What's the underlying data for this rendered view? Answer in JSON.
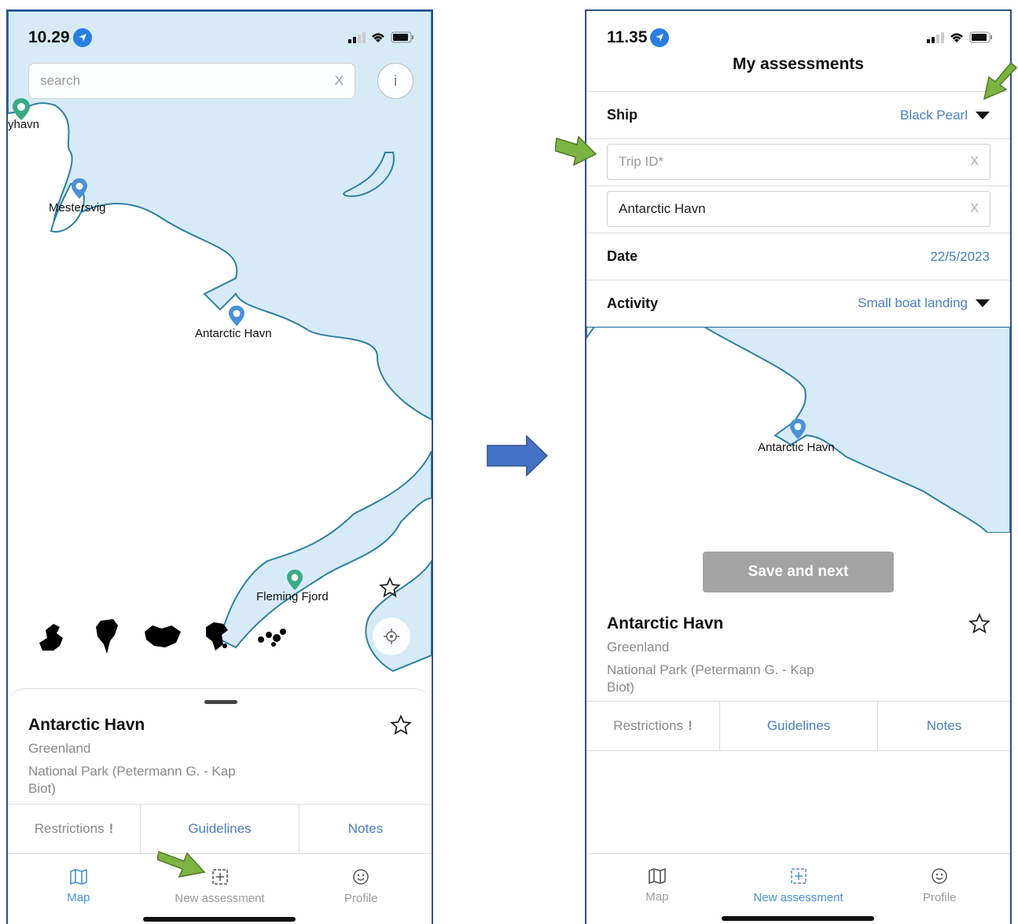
{
  "left_phone": {
    "status": {
      "time": "10.29"
    },
    "search": {
      "placeholder": "search",
      "clear": "X"
    },
    "info_button": "i",
    "map_labels": {
      "nyhavn": "yhavn",
      "mestersvig": "Mestersvig",
      "antarctic_havn": "Antarctic Havn",
      "fleming_fjord": "Fleming Fjord"
    },
    "sheet": {
      "title": "Antarctic Havn",
      "country": "Greenland",
      "description": "National Park (Petermann G. - Kap Biot)"
    },
    "tabs": {
      "restrictions": "Restrictions",
      "restrictions_mark": "!",
      "guidelines": "Guidelines",
      "notes": "Notes"
    },
    "nav": {
      "map": "Map",
      "new_assessment": "New assessment",
      "profile": "Profile",
      "active": "Map"
    }
  },
  "right_phone": {
    "status": {
      "time": "11.35"
    },
    "title": "My assessments",
    "ship": {
      "label": "Ship",
      "value": "Black Pearl"
    },
    "trip_id": {
      "placeholder": "Trip ID*",
      "clear": "X"
    },
    "location_field": {
      "value": "Antarctic Havn",
      "clear": "X"
    },
    "date": {
      "label": "Date",
      "value": "22/5/2023"
    },
    "activity": {
      "label": "Activity",
      "value": "Small boat landing"
    },
    "map_label": "Antarctic Havn",
    "save_button": "Save and next",
    "sheet": {
      "title": "Antarctic Havn",
      "country": "Greenland",
      "description": "National Park (Petermann G. - Kap Biot)"
    },
    "tabs": {
      "restrictions": "Restrictions",
      "restrictions_mark": "!",
      "guidelines": "Guidelines",
      "notes": "Notes"
    },
    "nav": {
      "map": "Map",
      "new_assessment": "New assessment",
      "profile": "Profile",
      "active": "New assessment"
    }
  },
  "colors": {
    "sea": "#d6ebf7",
    "coast": "#2f7fa3",
    "accent": "#4a7fc4",
    "pin_blue": "#4a90d9",
    "pin_green": "#3aaa86",
    "arrow_green": "#7cb342",
    "arrow_blue": "#4472c4",
    "button_disabled": "#a3a3a3"
  },
  "icons": [
    "location-arrow-icon",
    "signal-icon",
    "wifi-icon",
    "battery-icon",
    "map-icon",
    "new-assessment-icon",
    "profile-icon",
    "star-icon",
    "locate-icon",
    "map-pin-icon",
    "dropdown-caret-icon"
  ]
}
